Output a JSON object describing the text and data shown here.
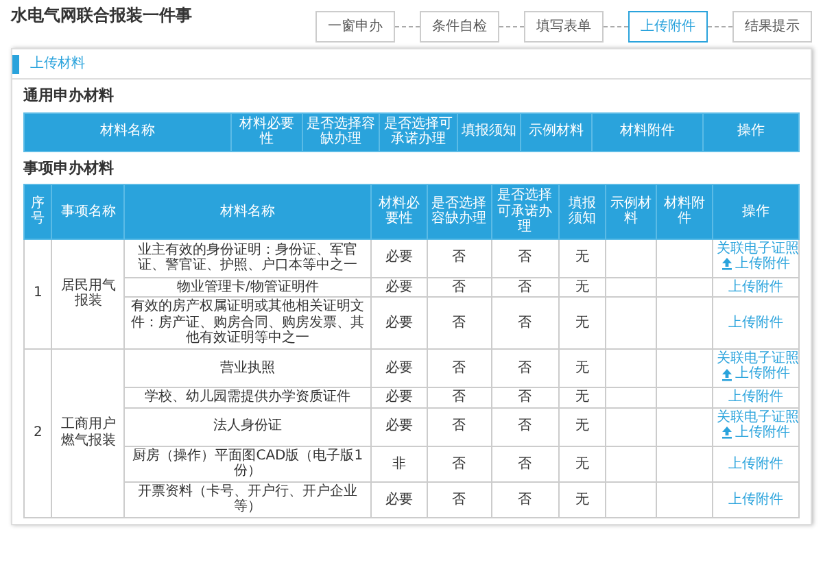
{
  "page_title": "水电气网联合报装一件事",
  "steps": [
    {
      "label": "一窗申办",
      "selected": false
    },
    {
      "label": "条件自检",
      "selected": false
    },
    {
      "label": "填写表单",
      "selected": false
    },
    {
      "label": "上传附件",
      "selected": true
    },
    {
      "label": "结果提示",
      "selected": false
    }
  ],
  "panel": {
    "title": "上传材料"
  },
  "general_materials": {
    "title": "通用申办材料",
    "columns": [
      "材料名称",
      "材料必要性",
      "是否选择容缺办理",
      "是否选择可承诺办理",
      "填报须知",
      "示例材料",
      "材料附件",
      "操作"
    ]
  },
  "item_materials": {
    "title": "事项申办材料",
    "columns": [
      "序号",
      "事项名称",
      "材料名称",
      "材料必要性",
      "是否选择容缺办理",
      "是否选择可承诺办理",
      "填报须知",
      "示例材料",
      "材料附件",
      "操作"
    ],
    "rows": [
      {
        "index": "1",
        "name": "居民用气报装",
        "materials": [
          {
            "name": "业主有效的身份证明：身份证、军官证、警官证、护照、户口本等中之一",
            "necessity": "必要",
            "allow_missing": "否",
            "allow_promise": "否",
            "notes": "无",
            "actions": [
              {
                "kind": "link",
                "label": "关联电子证照"
              },
              {
                "kind": "upload",
                "label": "上传附件"
              }
            ]
          },
          {
            "name": "物业管理卡/物管证明件",
            "necessity": "必要",
            "allow_missing": "否",
            "allow_promise": "否",
            "notes": "无",
            "actions": [
              {
                "kind": "link",
                "label": "上传附件"
              }
            ]
          },
          {
            "name": "有效的房产权属证明或其他相关证明文件：房产证、购房合同、购房发票、其他有效证明等中之一",
            "necessity": "必要",
            "allow_missing": "否",
            "allow_promise": "否",
            "notes": "无",
            "actions": [
              {
                "kind": "link",
                "label": "上传附件"
              }
            ]
          }
        ]
      },
      {
        "index": "2",
        "name": "工商用户燃气报装",
        "materials": [
          {
            "name": "营业执照",
            "necessity": "必要",
            "allow_missing": "否",
            "allow_promise": "否",
            "notes": "无",
            "actions": [
              {
                "kind": "link",
                "label": "关联电子证照"
              },
              {
                "kind": "upload",
                "label": "上传附件"
              }
            ]
          },
          {
            "name": "学校、幼儿园需提供办学资质证件",
            "necessity": "必要",
            "allow_missing": "否",
            "allow_promise": "否",
            "notes": "无",
            "actions": [
              {
                "kind": "link",
                "label": "上传附件"
              }
            ]
          },
          {
            "name": "法人身份证",
            "necessity": "必要",
            "allow_missing": "否",
            "allow_promise": "否",
            "notes": "无",
            "actions": [
              {
                "kind": "link",
                "label": "关联电子证照"
              },
              {
                "kind": "upload",
                "label": "上传附件"
              }
            ]
          },
          {
            "name": "厨房（操作）平面图CAD版（电子版1份）",
            "necessity": "非",
            "allow_missing": "否",
            "allow_promise": "否",
            "notes": "无",
            "actions": [
              {
                "kind": "link",
                "label": "上传附件"
              }
            ]
          },
          {
            "name": "开票资料（卡号、开户行、开户企业等）",
            "necessity": "必要",
            "allow_missing": "否",
            "allow_promise": "否",
            "notes": "无",
            "actions": [
              {
                "kind": "link",
                "label": "上传附件"
              }
            ]
          }
        ]
      }
    ]
  }
}
